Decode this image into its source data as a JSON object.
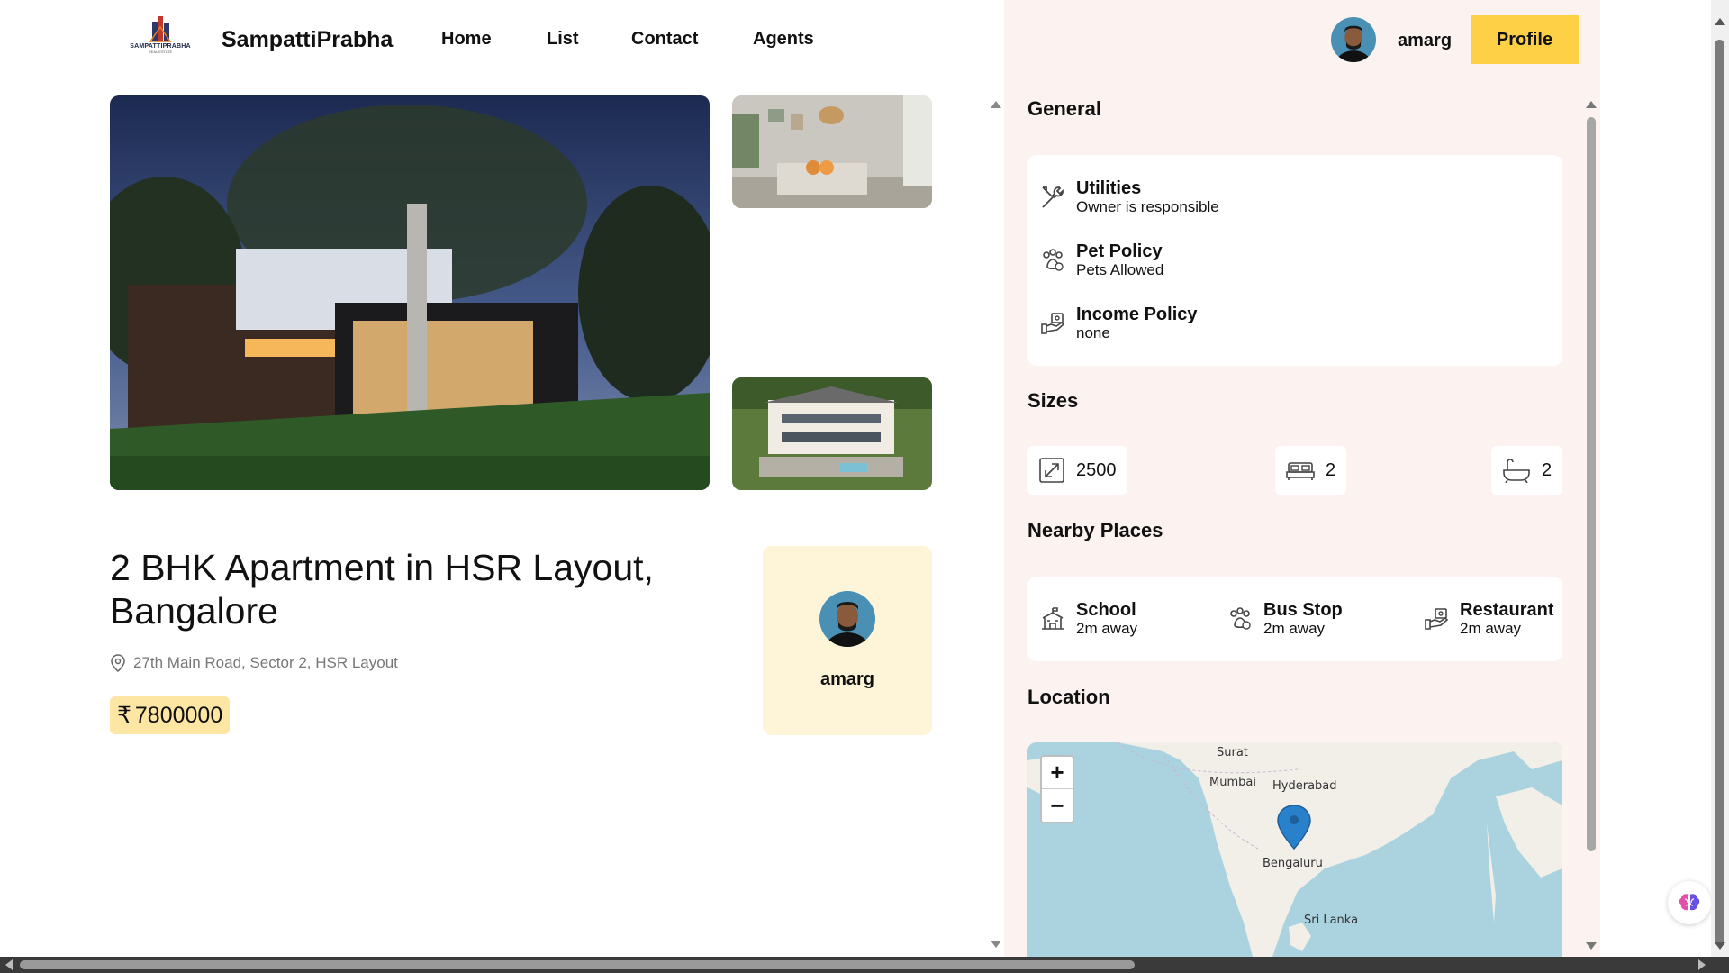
{
  "header": {
    "logo_text": "SAMPATTIPRABHA",
    "logo_sub": "REAL ESTATE",
    "brand": "SampattiPrabha",
    "nav": [
      "Home",
      "List",
      "Contact",
      "Agents"
    ],
    "user_name": "amarg",
    "profile_label": "Profile"
  },
  "listing": {
    "title": "2 BHK Apartment in HSR Layout, Bangalore",
    "address": "27th Main Road, Sector 2, HSR Layout",
    "currency_symbol": "₹",
    "price": "7800000",
    "owner_name": "amarg"
  },
  "general": {
    "title": "General",
    "items": [
      {
        "title": "Utilities",
        "desc": "Owner is responsible",
        "icon": "utilities-icon"
      },
      {
        "title": "Pet Policy",
        "desc": "Pets Allowed",
        "icon": "pet-icon"
      },
      {
        "title": "Income Policy",
        "desc": "none",
        "icon": "income-icon"
      }
    ]
  },
  "sizes": {
    "title": "Sizes",
    "area": "2500",
    "bedrooms": "2",
    "bathrooms": "2"
  },
  "nearby": {
    "title": "Nearby Places",
    "items": [
      {
        "title": "School",
        "desc": "2m away",
        "icon": "school-icon"
      },
      {
        "title": "Bus Stop",
        "desc": "2m away",
        "icon": "bus-stop-icon"
      },
      {
        "title": "Restaurant",
        "desc": "2m away",
        "icon": "restaurant-icon"
      }
    ]
  },
  "location": {
    "title": "Location",
    "zoom_in": "+",
    "zoom_out": "−",
    "labels": [
      "Surat",
      "Mumbai",
      "Hyderabad",
      "Bengaluru",
      "Sri Lanka"
    ]
  },
  "colors": {
    "accent": "#fed046",
    "price_bg": "#fde5a4",
    "owner_card_bg": "#fef4d8",
    "panel_bg": "#fcf2f0",
    "map_water": "#aad3df",
    "map_land": "#f2efe9"
  }
}
